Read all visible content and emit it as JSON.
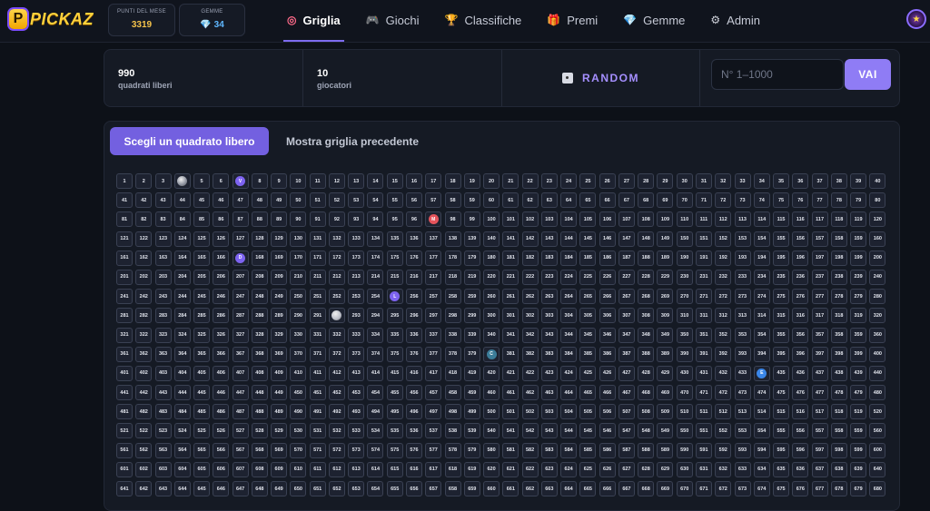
{
  "app": {
    "logo_letter": "P",
    "logo_text": "PICKAZ"
  },
  "header_stats": {
    "points_label": "PUNTI DEL MESE",
    "points_value": "3319",
    "gems_label": "GEMME",
    "gems_value": "34",
    "gem_icon": "gem-icon"
  },
  "nav": [
    {
      "label": "Griglia",
      "icon": "target-icon",
      "glyph": "◎",
      "color": "#ff6b8a",
      "active": true
    },
    {
      "label": "Giochi",
      "icon": "gamepad-icon",
      "glyph": "🎮",
      "color": "#8f7cf5",
      "active": false
    },
    {
      "label": "Classifiche",
      "icon": "trophy-icon",
      "glyph": "🏆",
      "color": "#f5c34b",
      "active": false
    },
    {
      "label": "Premi",
      "icon": "gift-icon",
      "glyph": "🎁",
      "color": "#ff6b6b",
      "active": false
    },
    {
      "label": "Gemme",
      "icon": "gem-icon",
      "glyph": "💎",
      "color": "#5fb8ff",
      "active": false
    },
    {
      "label": "Admin",
      "icon": "gear-icon",
      "glyph": "⚙",
      "color": "#d0d3dc",
      "active": false
    }
  ],
  "stats": {
    "free_count": "990",
    "free_label": "quadrati liberi",
    "players_count": "10",
    "players_label": "giocatori",
    "random_label": "RANDOM",
    "input_placeholder": "N° 1–1000",
    "go_label": "VAI"
  },
  "tabs": {
    "active": "Scegli un quadrato libero",
    "inactive": "Mostra griglia precedente"
  },
  "grid": {
    "visible_count": 680,
    "columns": 40,
    "taken": [
      {
        "n": 4,
        "label": "",
        "color": "#8a8f9c",
        "kind": "avatar"
      },
      {
        "n": 7,
        "label": "V",
        "color": "#7d63f0",
        "kind": "letter"
      },
      {
        "n": 97,
        "label": "M",
        "color": "#e4535b",
        "kind": "letter"
      },
      {
        "n": 167,
        "label": "D",
        "color": "#7d63f0",
        "kind": "letter"
      },
      {
        "n": 255,
        "label": "L",
        "color": "#7d63f0",
        "kind": "letter"
      },
      {
        "n": 292,
        "label": "",
        "color": "#b9bcc6",
        "kind": "avatar"
      },
      {
        "n": 380,
        "label": "C",
        "color": "#3b7c98",
        "kind": "letter"
      },
      {
        "n": 434,
        "label": "E",
        "color": "#3a86e8",
        "kind": "letter"
      }
    ]
  },
  "colors": {
    "background": "#0d1118",
    "panel": "#151a24",
    "accent": "#7360e0",
    "gold": "#f5c34b"
  }
}
